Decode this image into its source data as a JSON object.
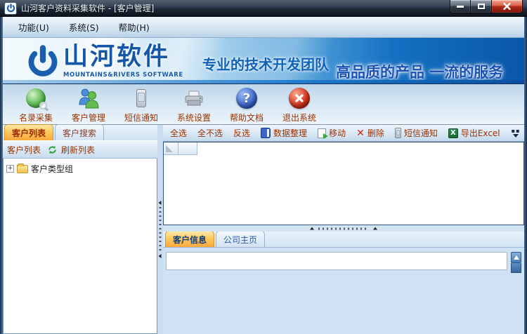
{
  "window": {
    "title": "山河客户资料采集软件 - [客户管理]"
  },
  "menu": {
    "items": [
      {
        "label": "功能(U)"
      },
      {
        "label": "系统(S)"
      },
      {
        "label": "帮助(H)"
      }
    ]
  },
  "banner": {
    "brand": "山河软件",
    "brand_sub": "MOUNTAINS&RIVERS SOFTWARE",
    "slogan_left": "专业的技术开发团队",
    "slogan_right": "高品质的产品 一流的服务"
  },
  "main_toolbar": {
    "buttons": [
      {
        "label": "名录采集",
        "icon": "globe-search-icon"
      },
      {
        "label": "客户管理",
        "icon": "users-icon"
      },
      {
        "label": "短信通知",
        "icon": "mobile-phone-icon"
      },
      {
        "label": "系统设置",
        "icon": "printer-icon"
      },
      {
        "label": "帮助文档",
        "icon": "help-icon"
      },
      {
        "label": "退出系统",
        "icon": "exit-icon"
      }
    ]
  },
  "left_panel": {
    "tabs": [
      {
        "label": "客户列表",
        "active": true
      },
      {
        "label": "客户搜索",
        "active": false
      }
    ],
    "list_header": {
      "title": "客户列表",
      "refresh_label": "刷新列表"
    },
    "tree": {
      "root_label": "客户类型组",
      "expander": "+"
    }
  },
  "customer_toolbar": {
    "items": [
      {
        "label": "全选",
        "icon": null
      },
      {
        "label": "全不选",
        "icon": null
      },
      {
        "label": "反选",
        "icon": null
      },
      {
        "label": "数据整理",
        "icon": "book-icon"
      },
      {
        "label": "移动",
        "icon": "move-page-icon"
      },
      {
        "label": "删除",
        "icon": "delete-x-icon"
      },
      {
        "label": "短信通知",
        "icon": "mobile-phone-icon"
      },
      {
        "label": "导出Excel",
        "icon": "excel-icon"
      }
    ],
    "delete_glyph": "✕",
    "excel_glyph": "X"
  },
  "bottom_panel": {
    "tabs": [
      {
        "label": "客户信息",
        "active": true
      },
      {
        "label": "公司主页",
        "active": false
      }
    ],
    "info_input": {
      "value": ""
    }
  },
  "icons": {
    "app_logo": "power-symbol",
    "minimize": "horizontal-bar",
    "maximize": "square-outline",
    "close": "x-mark",
    "refresh": "circular-green-arrows",
    "tree_expander": "plus-box",
    "tree_folder": "yellow-folder",
    "toolbar_overflow": "double-dot-chevron-down",
    "scroll_up": "triangle-up",
    "grid_select_all": "gray-corner-triangle",
    "help_glyph": "?"
  },
  "colors": {
    "toolbar_label": "#993300",
    "active_tab_orange": "#F9A83C",
    "banner_dark_blue": "#0A57A8",
    "brand_blue": "#1456A8",
    "close_button_red": "#B02A18",
    "help_ball_blue": "#3A66C8",
    "exit_ball_red": "#D83820"
  }
}
